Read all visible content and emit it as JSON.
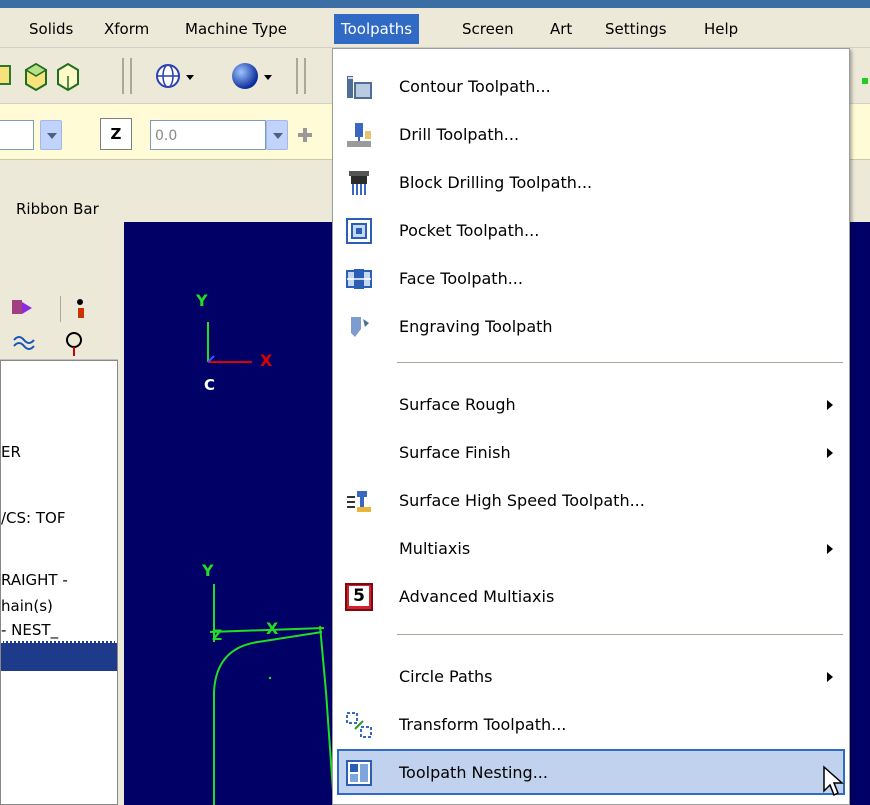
{
  "menubar": {
    "items": [
      "Solids",
      "Xform",
      "Machine Type",
      "Toolpaths",
      "Screen",
      "Art",
      "Settings",
      "Help"
    ],
    "active": "Toolpaths"
  },
  "toolbar": {
    "z_label": "Z",
    "z_value": "0.0",
    "ribbon_label": "Ribbon Bar"
  },
  "left_panel": {
    "lines": [
      "ER",
      "/CS: TOF",
      "RAIGHT -",
      "hain(s)",
      "- NEST_"
    ]
  },
  "graphics": {
    "axis_y": "Y",
    "axis_x": "X",
    "axis_c": "C",
    "axis2_y": "Y",
    "axis2_x": "X",
    "axis2_z": "Z"
  },
  "toolpaths_menu": {
    "items": [
      {
        "label": "Contour Toolpath...",
        "icon": "contour-icon",
        "submenu": false
      },
      {
        "label": "Drill Toolpath...",
        "icon": "drill-icon",
        "submenu": false
      },
      {
        "label": "Block Drilling Toolpath...",
        "icon": "block-drill-icon",
        "submenu": false
      },
      {
        "label": "Pocket Toolpath...",
        "icon": "pocket-icon",
        "submenu": false
      },
      {
        "label": "Face Toolpath...",
        "icon": "face-icon",
        "submenu": false
      },
      {
        "label": "Engraving Toolpath",
        "icon": "engraving-icon",
        "submenu": false
      },
      {
        "label": "Surface Rough",
        "icon": "",
        "submenu": true
      },
      {
        "label": "Surface Finish",
        "icon": "",
        "submenu": true
      },
      {
        "label": "Surface High Speed Toolpath...",
        "icon": "surface-high-speed-icon",
        "submenu": false
      },
      {
        "label": "Multiaxis",
        "icon": "",
        "submenu": true
      },
      {
        "label": "Advanced Multiaxis",
        "icon": "advanced-multiaxis-icon",
        "submenu": false
      },
      {
        "label": "Circle Paths",
        "icon": "",
        "submenu": true
      },
      {
        "label": "Transform Toolpath...",
        "icon": "transform-icon",
        "submenu": false
      },
      {
        "label": "Toolpath Nesting...",
        "icon": "nesting-icon",
        "submenu": false,
        "highlighted": true
      }
    ],
    "advanced_multiaxis_badge": "5"
  },
  "colors": {
    "menu_highlight": "#c1d2ee",
    "menubar_active": "#316ac5",
    "graphics_bg": "#000066",
    "axis_green": "#22dd22",
    "axis_red": "#dd0000"
  }
}
